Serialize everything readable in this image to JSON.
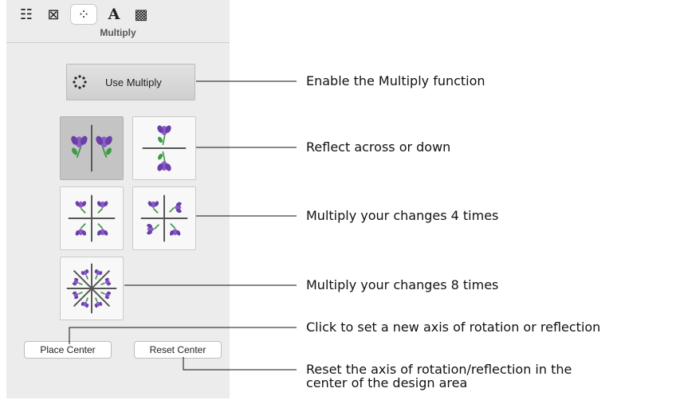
{
  "toolbar": {
    "items": [
      {
        "icon": "stitch-list-icon",
        "glyph": "☷"
      },
      {
        "icon": "cross-box-icon",
        "glyph": "⊠"
      },
      {
        "icon": "multiply-icon",
        "glyph": "⁘",
        "active": true
      },
      {
        "icon": "letter-a-icon",
        "glyph": "A"
      },
      {
        "icon": "pattern-fill-icon",
        "glyph": "▩"
      }
    ]
  },
  "panel": {
    "title": "Multiply",
    "use_button_label": "Use Multiply",
    "place_center_label": "Place Center",
    "reset_center_label": "Reset Center"
  },
  "tiles": [
    {
      "name": "reflect-across-tile",
      "selected": true
    },
    {
      "name": "reflect-down-tile",
      "selected": false
    },
    {
      "name": "multiply-4-a-tile",
      "selected": false
    },
    {
      "name": "multiply-4-b-tile",
      "selected": false
    },
    {
      "name": "multiply-8-tile",
      "selected": false
    }
  ],
  "callouts": {
    "enable": "Enable the Multiply function",
    "reflect": "Reflect across or down",
    "times4": "Multiply your changes 4 times",
    "times8": "Multiply your changes 8 times",
    "place": "Click to set a new axis of rotation or reflection",
    "reset_line1": "Reset the axis of rotation/reflection in the",
    "reset_line2": "center of the design area"
  },
  "colors": {
    "petal": "#8b5cc8",
    "petal_dark": "#6a3fa8",
    "leaf": "#3f9a48",
    "axis": "#555555"
  }
}
